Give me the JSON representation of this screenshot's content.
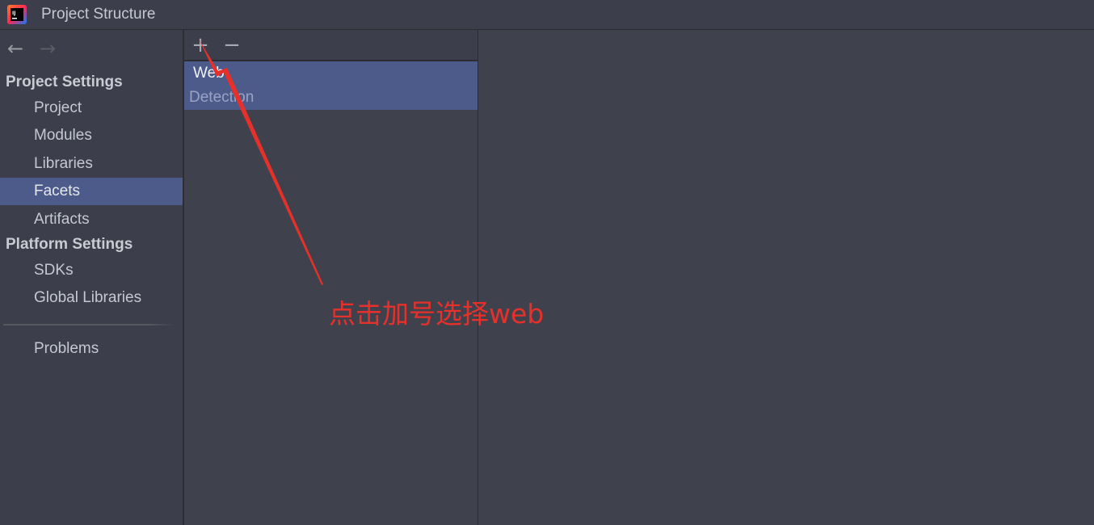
{
  "window": {
    "title": "Project Structure",
    "app_icon": "intellij-idea-icon"
  },
  "navigation": {
    "back_icon": "arrow-left-icon",
    "forward_icon": "arrow-right-icon",
    "back_glyph": "←",
    "forward_glyph": "→"
  },
  "sidebar": {
    "project_settings_header": "Project Settings",
    "project_items": [
      {
        "label": "Project"
      },
      {
        "label": "Modules"
      },
      {
        "label": "Libraries"
      },
      {
        "label": "Facets",
        "selected": true
      },
      {
        "label": "Artifacts"
      }
    ],
    "platform_settings_header": "Platform Settings",
    "platform_items": [
      {
        "label": "SDKs"
      },
      {
        "label": "Global Libraries"
      }
    ],
    "problems_label": "Problems"
  },
  "facets_panel": {
    "add_glyph": "+",
    "remove_glyph": "−",
    "items": [
      {
        "label": "Web"
      },
      {
        "label": "Detection"
      }
    ]
  },
  "annotation": {
    "text": "点击加号选择web",
    "color": "#e8302a"
  },
  "colors": {
    "background": "#3c3f4b",
    "panel": "#3f424d",
    "selection": "#4c5b8a",
    "text": "#c5c8d0"
  }
}
